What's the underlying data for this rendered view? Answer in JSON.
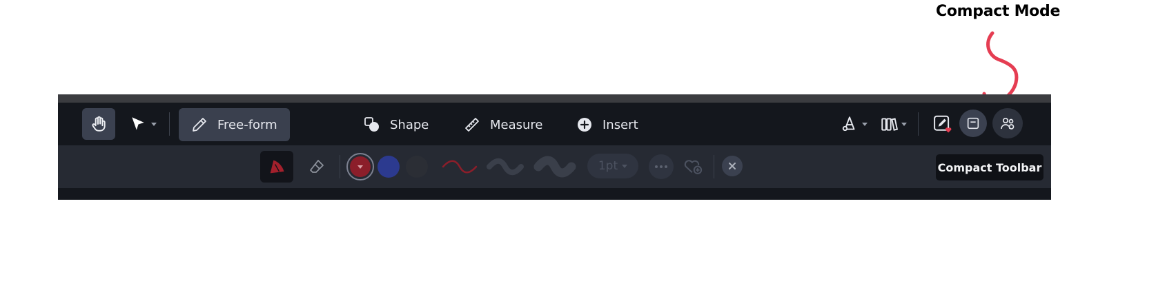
{
  "annotation": {
    "title": "Compact Mode",
    "arrow_color": "#e53d52"
  },
  "main_toolbar": {
    "pan_tool": {
      "icon": "hand-icon",
      "active": true
    },
    "select_tool": {
      "icon": "arrow-pointer-icon"
    },
    "modes": [
      {
        "label": "Free-form",
        "icon": "pencil-icon",
        "active": true
      },
      {
        "label": "Shape",
        "icon": "shapes-icon",
        "active": false
      },
      {
        "label": "Measure",
        "icon": "ruler-icon",
        "active": false
      },
      {
        "label": "Insert",
        "icon": "plus-circle-icon",
        "active": false
      }
    ],
    "right_tools": [
      {
        "icon": "cone-pin-icon"
      },
      {
        "icon": "binders-icon"
      },
      {
        "icon": "edit-favorite-icon"
      },
      {
        "icon": "compact-toolbar-icon"
      },
      {
        "icon": "collaborators-icon"
      }
    ]
  },
  "sub_toolbar": {
    "brush_icon": "brush-tool-icon",
    "eraser_icon": "eraser-icon",
    "colors": [
      "#8b1e2a",
      "#2c3a8f",
      "#2b2e35"
    ],
    "stroke_color": "#8b1e2a",
    "stroke_size": "1pt",
    "more_icon": "ellipsis-icon",
    "favorite_icon": "add-favorite-icon",
    "close_icon": "close-icon"
  },
  "tooltip": {
    "label": "Compact Toolbar"
  }
}
